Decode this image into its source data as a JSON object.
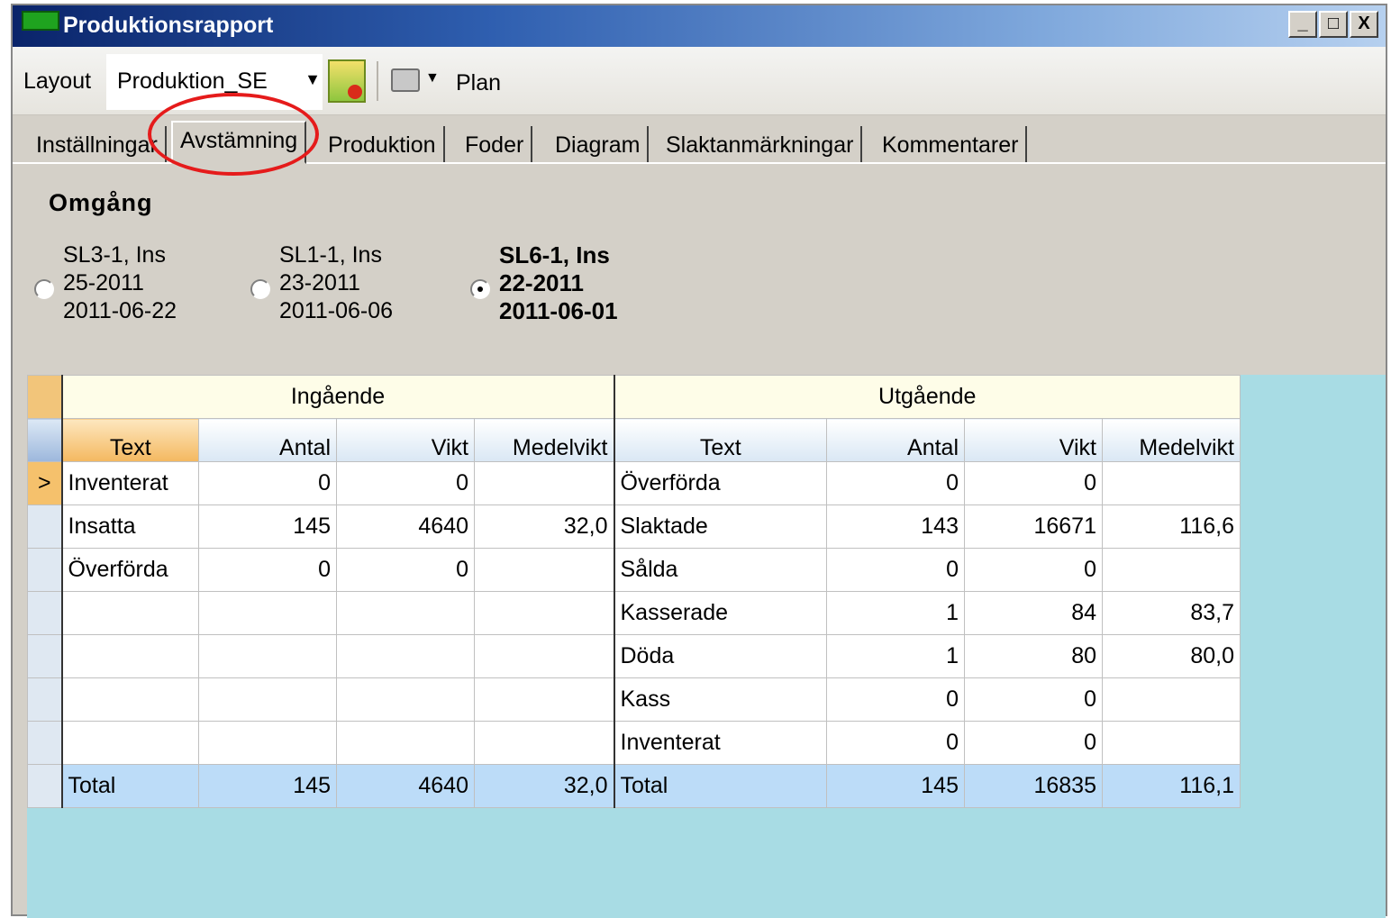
{
  "window": {
    "title": "Produktionsrapport",
    "controls": {
      "minimize": "_",
      "maximize": "□",
      "close": "X"
    }
  },
  "toolbar": {
    "layout_label": "Layout",
    "layout_value": "Produktion_SE",
    "plan_label": "Plan"
  },
  "tabs": [
    {
      "label": "Inställningar",
      "active": false
    },
    {
      "label": "Avstämning",
      "active": true
    },
    {
      "label": "Produktion",
      "active": false
    },
    {
      "label": "Foder",
      "active": false
    },
    {
      "label": "Diagram",
      "active": false
    },
    {
      "label": "Slaktanmärkningar",
      "active": false
    },
    {
      "label": "Kommentarer",
      "active": false
    }
  ],
  "omgang": {
    "title": "Omgång",
    "options": [
      {
        "line1": "SL3-1, Ins",
        "line2": "25-2011",
        "line3": "2011-06-22",
        "selected": false
      },
      {
        "line1": "SL1-1, Ins",
        "line2": "23-2011",
        "line3": "2011-06-06",
        "selected": false
      },
      {
        "line1": "SL6-1, Ins",
        "line2": "22-2011",
        "line3": "2011-06-01",
        "selected": true
      }
    ]
  },
  "grid": {
    "group_ingaende": "Ingående",
    "group_utgaende": "Utgående",
    "columns": [
      "Text",
      "Antal",
      "Vikt",
      "Medelvikt",
      "Text",
      "Antal",
      "Vikt",
      "Medelvikt"
    ],
    "current_row_marker": ">",
    "rows": [
      [
        "Inventerat",
        "0",
        "0",
        "",
        "Överförda",
        "0",
        "0",
        ""
      ],
      [
        "Insatta",
        "145",
        "4640",
        "32,0",
        "Slaktade",
        "143",
        "16671",
        "116,6"
      ],
      [
        "Överförda",
        "0",
        "0",
        "",
        "Sålda",
        "0",
        "0",
        ""
      ],
      [
        "",
        "",
        "",
        "",
        "Kasserade",
        "1",
        "84",
        "83,7"
      ],
      [
        "",
        "",
        "",
        "",
        "Döda",
        "1",
        "80",
        "80,0"
      ],
      [
        "",
        "",
        "",
        "",
        "Kass",
        "0",
        "0",
        ""
      ],
      [
        "",
        "",
        "",
        "",
        "Inventerat",
        "0",
        "0",
        ""
      ]
    ],
    "total": [
      "Total",
      "145",
      "4640",
      "32,0",
      "Total",
      "145",
      "16835",
      "116,1"
    ]
  },
  "colors": {
    "highlight_circle": "#e51b1b",
    "grid_background": "#a8dce4",
    "total_row": "#bcdcf8"
  }
}
